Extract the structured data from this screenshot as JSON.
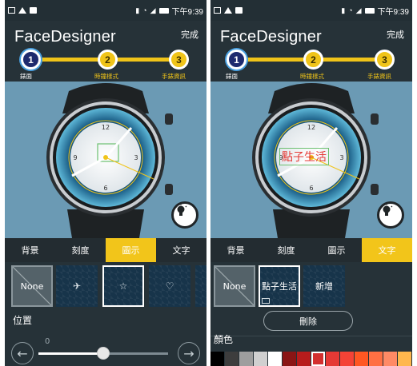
{
  "status_bar": {
    "time": "下午9:39"
  },
  "app": {
    "title": "FaceDesigner",
    "done_label": "完成"
  },
  "steps": [
    {
      "number": "1",
      "label": "錶面"
    },
    {
      "number": "2",
      "label": "時鐘樣式"
    },
    {
      "number": "3",
      "label": "手錶資訊"
    }
  ],
  "watch": {
    "dial_numbers": [
      "12",
      "3",
      "6",
      "9"
    ],
    "text_overlay": "點子生活",
    "accent_color": "#f0c419",
    "dial_ring_color": "#1e5c8a"
  },
  "tabs": [
    "背景",
    "刻度",
    "圖示",
    "文字"
  ],
  "left_screen": {
    "active_tab_index": 2,
    "thumbnails": [
      {
        "label": "None",
        "icon": "none"
      },
      {
        "label": "",
        "icon": "airplane-icon"
      },
      {
        "label": "",
        "icon": "star-icon"
      },
      {
        "label": "",
        "icon": "heart-icon"
      }
    ],
    "position_label": "位置",
    "slider_value": "0",
    "slider_fraction": 0.5
  },
  "right_screen": {
    "active_tab_index": 3,
    "thumbnails": [
      {
        "label": "None"
      },
      {
        "label": "點子生活"
      },
      {
        "label": "新增"
      }
    ],
    "delete_label": "刪除",
    "color_label": "顏色",
    "colors": [
      "#000000",
      "#3d3d3d",
      "#9e9e9e",
      "#d0d0d0",
      "#ffffff",
      "#8a1515",
      "#b71c1c",
      "#d32f2f",
      "#e53935",
      "#f44336",
      "#ff5722",
      "#ff7043",
      "#ff8a65",
      "#ffb74d"
    ],
    "selected_color_index": 7
  }
}
